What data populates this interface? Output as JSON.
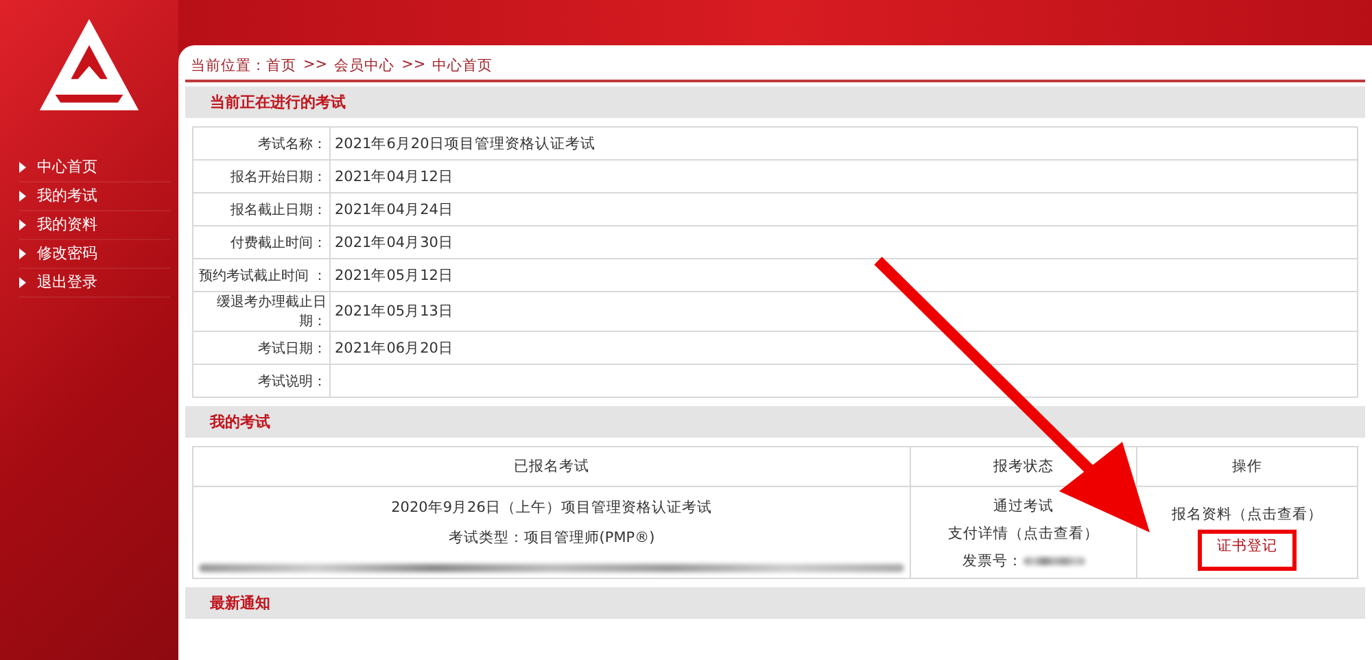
{
  "sidebar": {
    "items": [
      {
        "label": "中心首页"
      },
      {
        "label": "我的考试"
      },
      {
        "label": "我的资料"
      },
      {
        "label": "修改密码"
      },
      {
        "label": "退出登录"
      }
    ]
  },
  "breadcrumb": [
    "当前位置：首页",
    ">>",
    "会员中心",
    ">>",
    "中心首页"
  ],
  "current_exam": {
    "title": "当前正在进行的考试",
    "rows": [
      {
        "label": "考试名称：",
        "value": "2021年6月20日项目管理资格认证考试"
      },
      {
        "label": "报名开始日期：",
        "value": "2021年04月12日"
      },
      {
        "label": "报名截止日期：",
        "value": "2021年04月24日"
      },
      {
        "label": "付费截止时间：",
        "value": "2021年04月30日"
      },
      {
        "label": "预约考试截止时间 ：",
        "value": "2021年05月12日"
      },
      {
        "label": "缓退考办理截止日期：",
        "value": "2021年05月13日"
      },
      {
        "label": "考试日期：",
        "value": "2021年06月20日"
      },
      {
        "label": "考试说明："
      }
    ]
  },
  "my_exams": {
    "title": "我的考试",
    "columns": [
      "已报名考试",
      "报考状态",
      "操作"
    ],
    "rows": [
      {
        "exam_lines": [
          "2020年9月26日（上午）项目管理资格认证考试",
          "考试类型：项目管理师(PMP®)"
        ],
        "status": "通过考试",
        "payment_link": "支付详情（点击查看）",
        "invoice_label": "发票号：",
        "actions": [
          {
            "label": "报名资料（点击查看）",
            "highlighted": false
          },
          {
            "label": "证书登记",
            "highlighted": true
          }
        ]
      }
    ]
  },
  "notices": {
    "title": "最新通知"
  },
  "annotation": {
    "kind": "arrow"
  }
}
